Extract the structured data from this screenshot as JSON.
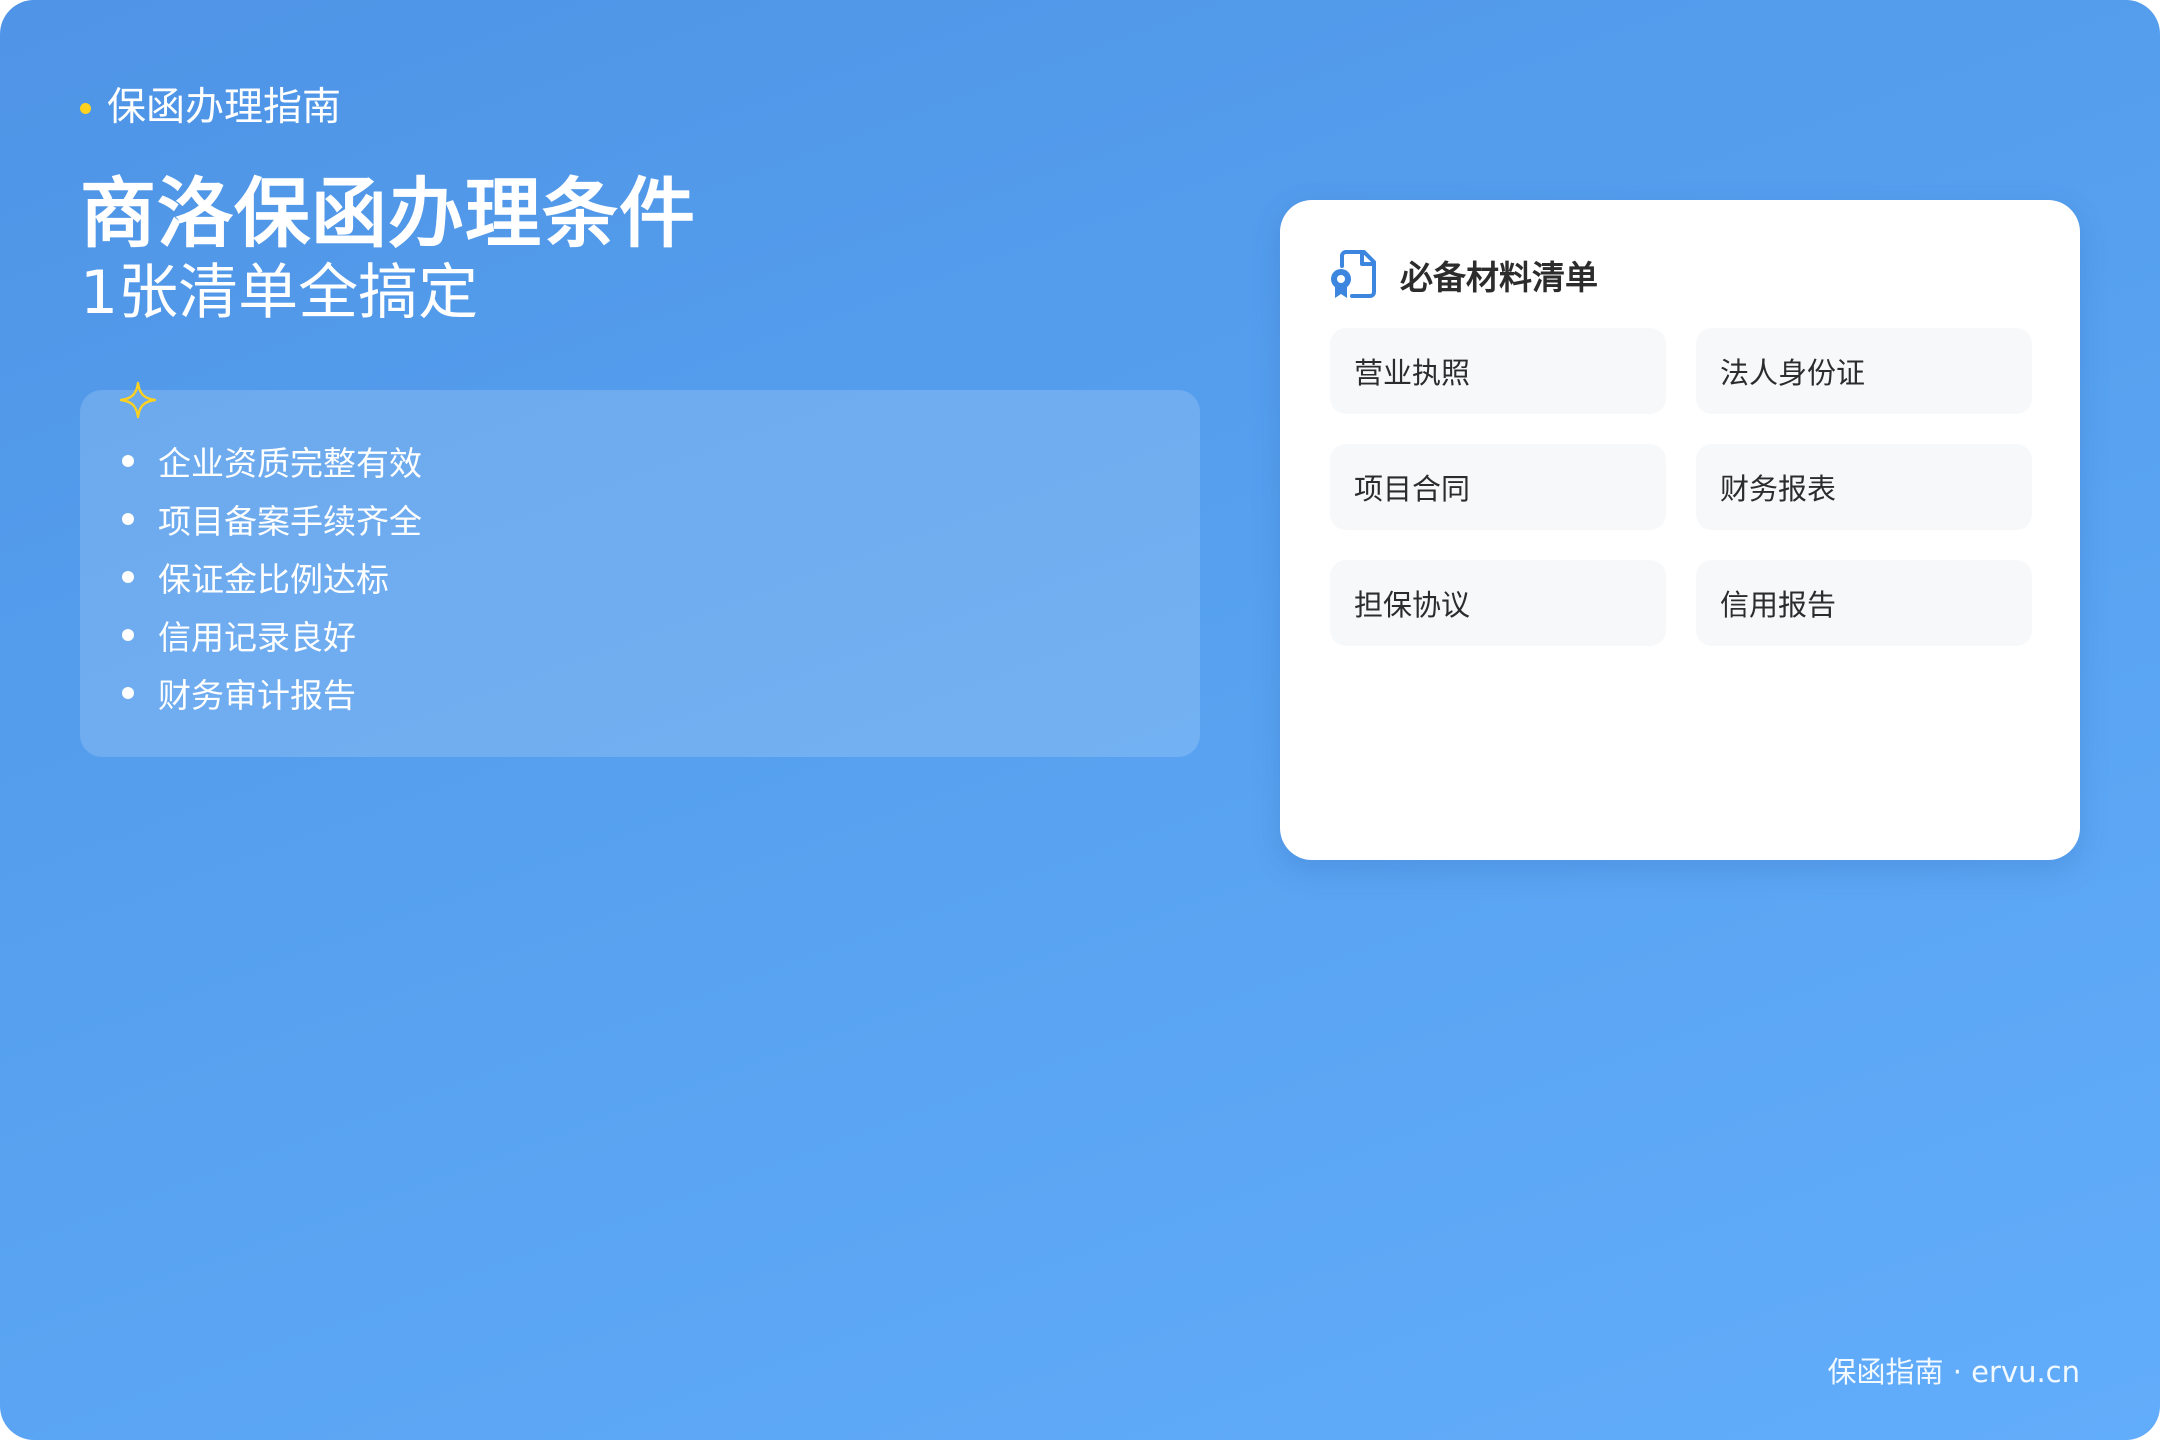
{
  "header": {
    "kicker": "保函办理指南",
    "title": "商洛保函办理条件",
    "subtitle": "1张清单全搞定"
  },
  "conditions": {
    "sparkle_icon": "sparkle-icon",
    "items": [
      "企业资质完整有效",
      "项目备案手续齐全",
      "保证金比例达标",
      "信用记录良好",
      "财务审计报告"
    ]
  },
  "materials": {
    "icon": "document-certificate-icon",
    "title": "必备材料清单",
    "items": [
      "营业执照",
      "法人身份证",
      "项目合同",
      "财务报表",
      "担保协议",
      "信用报告"
    ]
  },
  "footer": {
    "text": "保函指南 · ervu.cn"
  },
  "colors": {
    "background_start": "#4f94e6",
    "background_end": "#62adfb",
    "accent_yellow": "#ffd21f",
    "icon_blue": "#3c86e0",
    "card_bg": "#ffffff",
    "item_bg": "#f6f8fa",
    "text_dark": "#2c2c2c"
  }
}
